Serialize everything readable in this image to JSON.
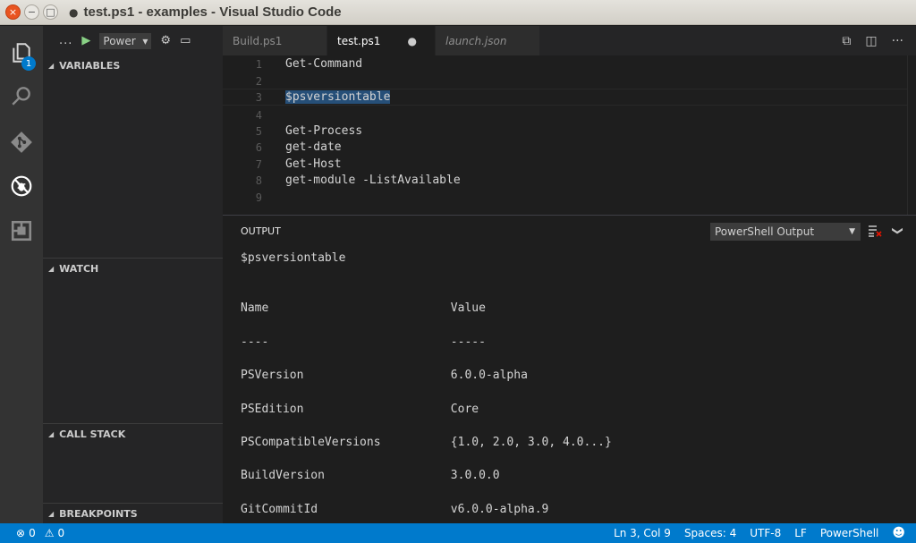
{
  "window": {
    "title": "test.ps1 - examples - Visual Studio Code",
    "close_glyph": "×",
    "minimize_glyph": "−",
    "maximize_glyph": "□",
    "dirty_glyph": "●"
  },
  "activity_bar": {
    "explorer_badge": "1",
    "items": [
      "files-icon",
      "search-icon",
      "git-icon",
      "debug-icon",
      "extensions-icon"
    ]
  },
  "debug_toolbar": {
    "more_label": "...",
    "play_glyph": "▶",
    "config_value": "Power",
    "config_caret": "▾",
    "gear_glyph": "⚙",
    "console_glyph": "▭"
  },
  "sidebar": {
    "sections": [
      "VARIABLES",
      "WATCH",
      "CALL STACK",
      "BREAKPOINTS"
    ],
    "collapse_glyph": "◢"
  },
  "tabs": [
    {
      "label": "Build.ps1",
      "active": false
    },
    {
      "label": "test.ps1",
      "active": true,
      "modified_glyph": "●"
    },
    {
      "label": "launch.json",
      "active": false
    }
  ],
  "tab_actions": {
    "open_changes_glyph": "⧉",
    "split_glyph": "◫",
    "more_glyph": "···"
  },
  "editor": {
    "lines": [
      {
        "num": "1",
        "text": "Get-Command"
      },
      {
        "num": "2",
        "text": ""
      },
      {
        "num": "3",
        "text": "$psversiontable"
      },
      {
        "num": "4",
        "text": ""
      },
      {
        "num": "5",
        "text": "Get-Process"
      },
      {
        "num": "6",
        "text": "get-date"
      },
      {
        "num": "7",
        "text": "Get-Host"
      },
      {
        "num": "8",
        "text": "get-module -ListAvailable"
      },
      {
        "num": "9",
        "text": ""
      }
    ]
  },
  "panel": {
    "title": "OUTPUT",
    "channel": "PowerShell Output",
    "channel_caret": "▼",
    "collapse_glyph": "❯",
    "lines": [
      "$psversiontable",
      "",
      "Name                          Value",
      "----                          -----",
      "PSVersion                     6.0.0-alpha",
      "PSEdition                     Core",
      "PSCompatibleVersions          {1.0, 2.0, 3.0, 4.0...}",
      "BuildVersion                  3.0.0.0",
      "GitCommitId                   v6.0.0-alpha.9"
    ]
  },
  "status": {
    "error_glyph": "⊗",
    "errors": "0",
    "warning_glyph": "⚠",
    "warnings": "0",
    "position": "Ln 3, Col 9",
    "spaces": "Spaces: 4",
    "encoding": "UTF-8",
    "eol": "LF",
    "language": "PowerShell",
    "feedback_glyph": "☻"
  }
}
